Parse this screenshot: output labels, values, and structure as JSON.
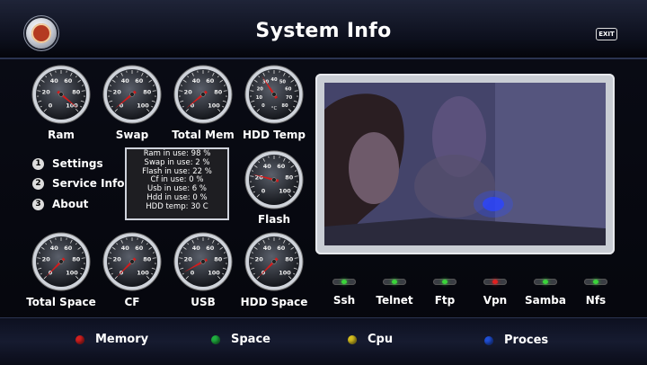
{
  "header": {
    "title": "System Info",
    "exit_label": "EXIT"
  },
  "colors": {
    "needle": "#d61b1b",
    "led_green": "#3ad53a",
    "led_red": "#e02020",
    "key_red": "#d42020",
    "key_green": "#20b040",
    "key_yellow": "#d8c020",
    "key_blue": "#2050d8"
  },
  "gauges": [
    {
      "label": "Ram",
      "value": 98,
      "scale": [
        0,
        20,
        40,
        60,
        80,
        100
      ]
    },
    {
      "label": "Swap",
      "value": 2,
      "scale": [
        0,
        20,
        40,
        60,
        80,
        100
      ]
    },
    {
      "label": "Total Mem",
      "value": 2,
      "scale": [
        0,
        20,
        40,
        60,
        80,
        100
      ]
    },
    {
      "label": "HDD Temp",
      "value": 30,
      "unit": "°C",
      "scale": [
        0,
        10,
        20,
        30,
        40,
        50,
        60,
        70,
        80
      ]
    },
    {
      "label": "Flash",
      "value": 22,
      "scale": [
        0,
        20,
        40,
        60,
        80,
        100
      ]
    },
    {
      "label": "Total Space",
      "value": 0,
      "scale": [
        0,
        20,
        40,
        60,
        80,
        100
      ]
    },
    {
      "label": "CF",
      "value": 0,
      "scale": [
        0,
        20,
        40,
        60,
        80,
        100
      ]
    },
    {
      "label": "USB",
      "value": 6,
      "scale": [
        0,
        20,
        40,
        60,
        80,
        100
      ]
    },
    {
      "label": "HDD Space",
      "value": 0,
      "scale": [
        0,
        20,
        40,
        60,
        80,
        100
      ]
    }
  ],
  "menu": [
    {
      "num": "1",
      "label": "Settings"
    },
    {
      "num": "2",
      "label": "Service Info"
    },
    {
      "num": "3",
      "label": "About"
    }
  ],
  "info_lines": [
    "Ram in use: 98 %",
    "Swap in use: 2 %",
    "Flash in use: 22 %",
    "Cf in use: 0 %",
    "Usb in use: 6 %",
    "Hdd in use: 0 %",
    "HDD temp: 30 C"
  ],
  "services": [
    {
      "label": "Ssh",
      "status": "green"
    },
    {
      "label": "Telnet",
      "status": "green"
    },
    {
      "label": "Ftp",
      "status": "green"
    },
    {
      "label": "Vpn",
      "status": "red"
    },
    {
      "label": "Samba",
      "status": "green"
    },
    {
      "label": "Nfs",
      "status": "green"
    }
  ],
  "footer": [
    {
      "color": "red",
      "label": "Memory"
    },
    {
      "color": "green",
      "label": "Space"
    },
    {
      "color": "yellow",
      "label": "Cpu"
    },
    {
      "color": "blue",
      "label": "Proces"
    }
  ]
}
